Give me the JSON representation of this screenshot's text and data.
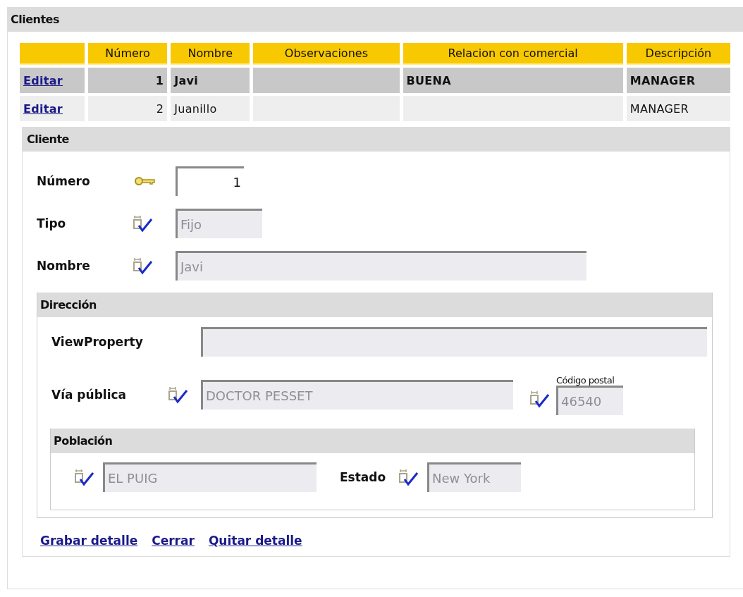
{
  "panel": {
    "title": "Clientes"
  },
  "table": {
    "columns": [
      "",
      "Número",
      "Nombre",
      "Observaciones",
      "Relacion con comercial",
      "Descripción"
    ],
    "rows": [
      {
        "selected": true,
        "cells": [
          "Editar",
          "1",
          "Javi",
          "",
          "BUENA",
          "MANAGER"
        ]
      },
      {
        "selected": false,
        "cells": [
          "Editar",
          "2",
          "Juanillo",
          "",
          "",
          "MANAGER"
        ]
      }
    ]
  },
  "detail": {
    "title": "Cliente",
    "fields": [
      {
        "label": "Número",
        "kind": "key",
        "value": "1",
        "disabled": false,
        "wide": false
      },
      {
        "label": "Tipo",
        "kind": "required",
        "value": "Fijo",
        "disabled": true,
        "wide": false
      },
      {
        "label": "Nombre",
        "kind": "required",
        "value": "Javi",
        "disabled": true,
        "wide": true
      }
    ],
    "address": {
      "title": "Dirección",
      "view_property": {
        "label": "ViewProperty",
        "disabled": true
      },
      "street": {
        "label": "Vía pública",
        "kind": "required",
        "value": "DOCTOR PESSET",
        "disabled": true
      },
      "postal_code": {
        "label": "Código postal",
        "kind": "required",
        "value": "46540",
        "disabled": true
      },
      "town": {
        "title": "Población",
        "city": {
          "kind": "required",
          "value": "EL PUIG",
          "disabled": true
        },
        "state": {
          "label": "Estado",
          "kind": "required",
          "value": "New York",
          "disabled": true
        }
      }
    }
  },
  "actions": [
    "Grabar detalle",
    "Cerrar",
    "Quitar detalle"
  ]
}
